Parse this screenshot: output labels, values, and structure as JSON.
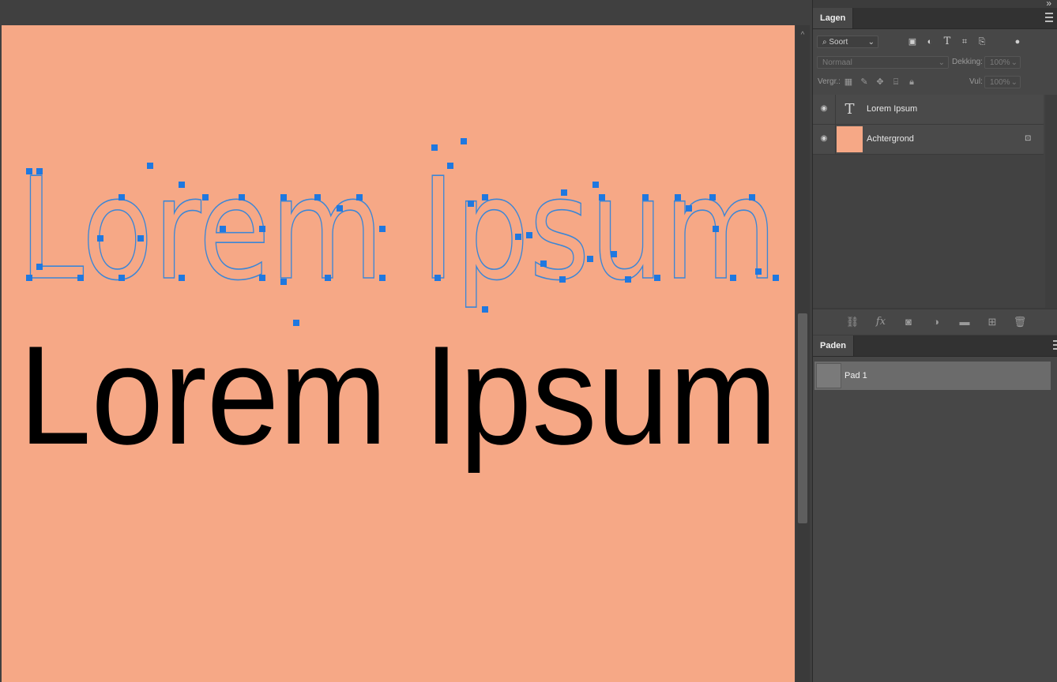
{
  "canvas": {
    "background": "#f6a886",
    "text_outline": "Lorem Ipsum",
    "text_solid": "Lorem Ipsum",
    "outline_color": "#3b86d6",
    "anchor_color": "#1f78e0",
    "text_color": "#000000"
  },
  "layers_panel": {
    "tab_label": "Lagen",
    "filter_label": "Soort",
    "blend_mode": "Normaal",
    "opacity_label": "Dekking:",
    "opacity_value": "100%",
    "lock_label": "Vergr.:",
    "fill_label": "Vul:",
    "fill_value": "100%",
    "layers": [
      {
        "name": "Lorem Ipsum",
        "type": "text",
        "icon": "text-layer-icon"
      },
      {
        "name": "Achtergrond",
        "type": "background",
        "icon": "lock-icon",
        "thumb_color": "#f6a886"
      }
    ]
  },
  "paths_panel": {
    "tab_label": "Paden",
    "paths": [
      {
        "name": "Pad 1"
      }
    ]
  }
}
